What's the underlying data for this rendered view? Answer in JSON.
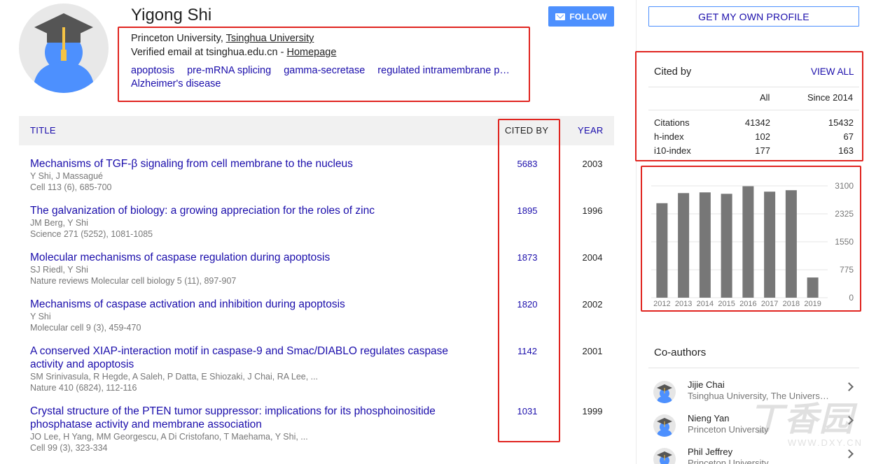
{
  "profile": {
    "name": "Yigong Shi",
    "affiliation_prefix": "Princeton University, ",
    "affiliation_link": "Tsinghua University",
    "email_text": "Verified email at tsinghua.edu.cn - ",
    "homepage": "Homepage",
    "interests": [
      "apoptosis",
      "pre-mRNA splicing",
      "gamma-secretase",
      "regulated intramembrane p…",
      "Alzheimer's disease"
    ],
    "follow_label": "FOLLOW"
  },
  "table": {
    "headers": {
      "title": "TITLE",
      "cited_by": "CITED BY",
      "year": "YEAR"
    },
    "rows": [
      {
        "title": "Mechanisms of TGF-β signaling from cell membrane to the nucleus",
        "authors": "Y Shi, J Massagué",
        "venue": "Cell 113 (6), 685-700",
        "cited_by": "5683",
        "year": "2003"
      },
      {
        "title": "The galvanization of biology: a growing appreciation for the roles of zinc",
        "authors": "JM Berg, Y Shi",
        "venue": "Science 271 (5252), 1081-1085",
        "cited_by": "1895",
        "year": "1996"
      },
      {
        "title": "Molecular mechanisms of caspase regulation during apoptosis",
        "authors": "SJ Riedl, Y Shi",
        "venue": "Nature reviews Molecular cell biology 5 (11), 897-907",
        "cited_by": "1873",
        "year": "2004"
      },
      {
        "title": "Mechanisms of caspase activation and inhibition during apoptosis",
        "authors": "Y Shi",
        "venue": "Molecular cell 9 (3), 459-470",
        "cited_by": "1820",
        "year": "2002"
      },
      {
        "title": "A conserved XIAP-interaction motif in caspase-9 and Smac/DIABLO regulates caspase activity and apoptosis",
        "authors": "SM Srinivasula, R Hegde, A Saleh, P Datta, E Shiozaki, J Chai, RA Lee, ...",
        "venue": "Nature 410 (6824), 112-116",
        "cited_by": "1142",
        "year": "2001"
      },
      {
        "title": "Crystal structure of the PTEN tumor suppressor: implications for its phosphoinositide phosphatase activity and membrane association",
        "authors": "JO Lee, H Yang, MM Georgescu, A Di Cristofano, T Maehama, Y Shi, ...",
        "venue": "Cell 99 (3), 323-334",
        "cited_by": "1031",
        "year": "1999"
      }
    ]
  },
  "sidebar": {
    "get_profile_label": "GET MY OWN PROFILE",
    "cited_by_title": "Cited by",
    "view_all": "VIEW ALL",
    "col_all": "All",
    "col_since": "Since 2014",
    "stats": [
      {
        "label": "Citations",
        "all": "41342",
        "since": "15432"
      },
      {
        "label": "h-index",
        "all": "102",
        "since": "67"
      },
      {
        "label": "i10-index",
        "all": "177",
        "since": "163"
      }
    ],
    "coauthors_title": "Co-authors",
    "coauthors": [
      {
        "name": "Jijie Chai",
        "affiliation": "Tsinghua University, The Univers…"
      },
      {
        "name": "Nieng Yan",
        "affiliation": "Princeton University"
      },
      {
        "name": "Phil Jeffrey",
        "affiliation": "Princeton University"
      }
    ]
  },
  "chart_data": {
    "type": "bar",
    "categories": [
      "2012",
      "2013",
      "2014",
      "2015",
      "2016",
      "2017",
      "2018",
      "2019"
    ],
    "values": [
      2620,
      2900,
      2920,
      2880,
      3090,
      2940,
      2980,
      560
    ],
    "yticks": [
      "3100",
      "2325",
      "1550",
      "775",
      "0"
    ],
    "ylim": [
      0,
      3100
    ],
    "bar_color": "#777777",
    "grid": true
  },
  "watermark": {
    "big": "丁香园",
    "small": "WWW.DXY.CN"
  },
  "colors": {
    "link": "#1a0dab",
    "accent": "#4d90fe",
    "highlight": "#e0241f"
  }
}
